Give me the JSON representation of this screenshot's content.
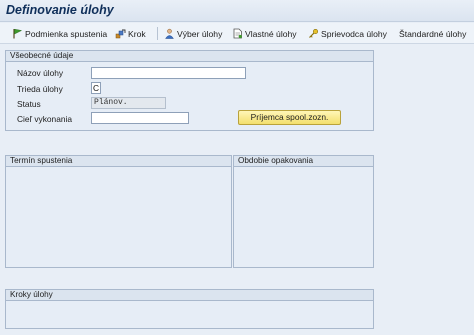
{
  "window": {
    "title": "Definovanie úlohy"
  },
  "toolbar": {
    "items": [
      {
        "label": "Podmienka spustenia",
        "icon": "flag-icon"
      },
      {
        "label": "Krok",
        "icon": "steps-icon"
      },
      {
        "label": "Výber úlohy",
        "icon": "person-select-icon"
      },
      {
        "label": "Vlastné úlohy",
        "icon": "document-icon"
      },
      {
        "label": "Sprievodca úlohy",
        "icon": "wizard-key-icon"
      },
      {
        "label": "Štandardné úlohy",
        "icon": ""
      }
    ]
  },
  "general": {
    "header": "Všeobecné údaje",
    "job_name": {
      "label": "Názov úlohy",
      "value": ""
    },
    "job_class": {
      "label": "Trieda úlohy",
      "value": "C"
    },
    "status": {
      "label": "Status",
      "value": "Plánov."
    },
    "target": {
      "label": "Cieľ vykonania",
      "value": ""
    },
    "spool_button": "Príjemca spool.zozn."
  },
  "start_panel": {
    "header": "Termín spustenia"
  },
  "period_panel": {
    "header": "Obdobie opakovania"
  },
  "steps_panel": {
    "header": "Kroky úlohy"
  },
  "colors": {
    "background": "#e8eef6",
    "group_border": "#a9b8cc",
    "button_yellow": "#f3df6d",
    "title_text": "#0f2f5a"
  }
}
